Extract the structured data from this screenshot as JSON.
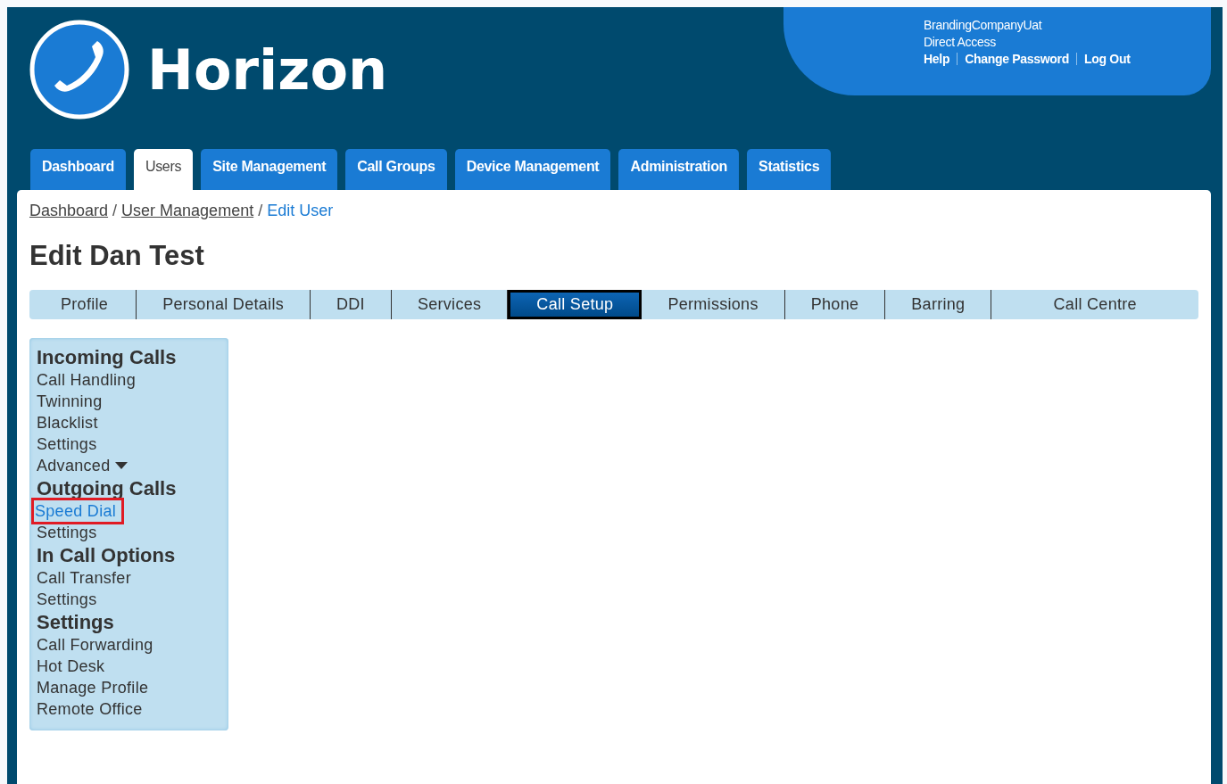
{
  "header": {
    "brand": "Horizon",
    "account": {
      "company": "BrandingCompanyUat",
      "access": "Direct Access",
      "links": [
        "Help",
        "Change Password",
        "Log Out"
      ]
    }
  },
  "main_tabs": [
    {
      "label": "Dashboard",
      "selected": false
    },
    {
      "label": "Users",
      "selected": true
    },
    {
      "label": "Site Management",
      "selected": false
    },
    {
      "label": "Call Groups",
      "selected": false
    },
    {
      "label": "Device Management",
      "selected": false
    },
    {
      "label": "Administration",
      "selected": false
    },
    {
      "label": "Statistics",
      "selected": false
    }
  ],
  "breadcrumb": [
    {
      "text": "Dashboard",
      "kind": "link"
    },
    {
      "text": "/",
      "kind": "separator"
    },
    {
      "text": "User Management",
      "kind": "link"
    },
    {
      "text": "/",
      "kind": "separator"
    },
    {
      "text": "Edit User",
      "kind": "current"
    }
  ],
  "page_title": "Edit Dan Test",
  "sub_tabs": [
    {
      "label": "Profile",
      "selected": false
    },
    {
      "label": "Personal Details",
      "selected": false
    },
    {
      "label": "DDI",
      "selected": false
    },
    {
      "label": "Services",
      "selected": false
    },
    {
      "label": "Call Setup",
      "selected": true
    },
    {
      "label": "Permissions",
      "selected": false
    },
    {
      "label": "Phone",
      "selected": false
    },
    {
      "label": "Barring",
      "selected": false
    },
    {
      "label": "Call Centre",
      "selected": false
    }
  ],
  "side_menu": [
    {
      "heading": "Incoming Calls",
      "items": [
        {
          "label": "Call Handling",
          "kind": "link",
          "selected": false
        },
        {
          "label": "Twinning",
          "kind": "link",
          "selected": false
        },
        {
          "label": "Blacklist",
          "kind": "link",
          "selected": false
        },
        {
          "label": "Settings",
          "kind": "link",
          "selected": false
        },
        {
          "label": "Advanced",
          "kind": "dropdown",
          "selected": false
        }
      ]
    },
    {
      "heading": "Outgoing Calls",
      "items": [
        {
          "label": "Speed Dial",
          "kind": "link",
          "selected": true
        },
        {
          "label": "Settings",
          "kind": "link",
          "selected": false
        }
      ]
    },
    {
      "heading": "In Call Options",
      "items": [
        {
          "label": "Call Transfer",
          "kind": "link",
          "selected": false
        },
        {
          "label": "Settings",
          "kind": "link",
          "selected": false
        }
      ]
    },
    {
      "heading": "Settings",
      "items": [
        {
          "label": "Call Forwarding",
          "kind": "link",
          "selected": false
        },
        {
          "label": "Hot Desk",
          "kind": "link",
          "selected": false
        },
        {
          "label": "Manage Profile",
          "kind": "link",
          "selected": false
        },
        {
          "label": "Remote Office",
          "kind": "link",
          "selected": false
        }
      ]
    }
  ]
}
